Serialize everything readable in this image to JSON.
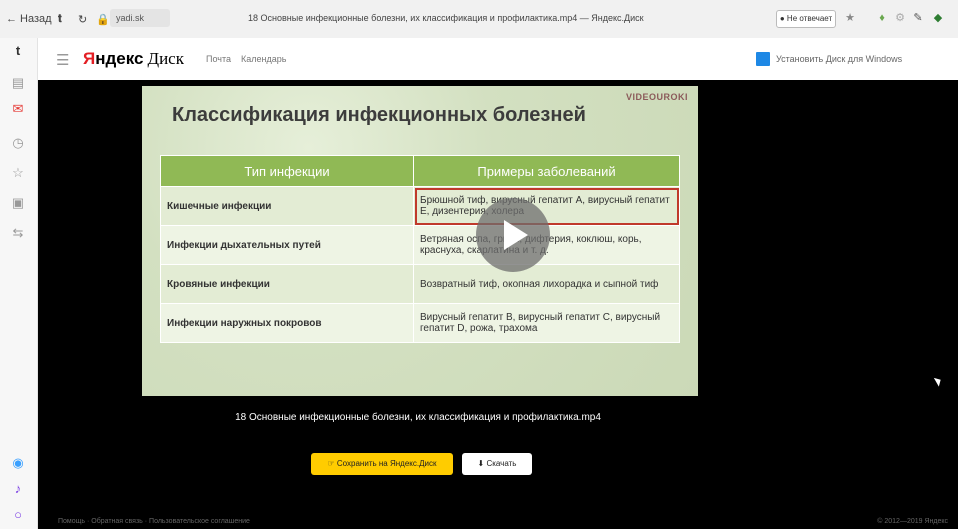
{
  "browser": {
    "back_label": "← Назад",
    "url_text": "yadi.sk",
    "tab_title": "18 Основные инфекционные болезни, их классификация и профилактика.mp4 — Яндекс.Диск",
    "ext_pill": "● Не отвечает",
    "icons": [
      "user-icon",
      "refresh-icon",
      "lock-icon",
      "extension-icon",
      "extension-icon",
      "extension-icon",
      "extension-icon"
    ]
  },
  "rail": {
    "items": [
      {
        "name": "rail-tab-icon-1",
        "glyph": "t",
        "color": "#333"
      },
      {
        "name": "rail-tab-icon-2",
        "glyph": "▤",
        "color": "#999"
      },
      {
        "name": "rail-mail-icon",
        "glyph": "✉",
        "color": "#e53935"
      },
      {
        "name": "rail-clock-icon",
        "glyph": "◷",
        "color": "#999"
      },
      {
        "name": "rail-star-icon",
        "glyph": "☆",
        "color": "#999"
      },
      {
        "name": "rail-notes-icon",
        "glyph": "▣",
        "color": "#999"
      },
      {
        "name": "rail-translate-icon",
        "glyph": "⇆",
        "color": "#999"
      }
    ],
    "bottom": [
      {
        "name": "rail-alice-icon",
        "glyph": "◉",
        "color": "#3aa0ff"
      },
      {
        "name": "rail-music-icon",
        "glyph": "♪",
        "color": "#7b3fe4"
      },
      {
        "name": "rail-ring-icon",
        "glyph": "○",
        "color": "#7b3fe4"
      }
    ]
  },
  "header": {
    "logo_red": "Я",
    "logo_black": "ндекс",
    "logo_disk": "Диск",
    "links": [
      "Почта",
      "Календарь"
    ],
    "install_label": "Установить Диск для Windows"
  },
  "slide": {
    "brand": "VIDEOUROKI",
    "title": "Классификация инфекционных болезней",
    "col1": "Тип инфекции",
    "col2": "Примеры заболеваний",
    "rows": [
      {
        "type": "Кишечные инфекции",
        "examples": "Брюшной тиф, вирусный гепатит А, вирусный гепатит Е, дизентерия, холера"
      },
      {
        "type": "Инфекции дыхательных путей",
        "examples": "Ветряная оспа, грипп, дифтерия, коклюш, корь, краснуха, скарлатина и т. д."
      },
      {
        "type": "Кровяные инфекции",
        "examples": "Возвратный тиф, окопная лихорадка и сыпной тиф"
      },
      {
        "type": "Инфекции наружных покровов",
        "examples": "Вирусный гепатит В, вирусный гепатит С, вирусный гепатит D, рожа, трахома"
      }
    ]
  },
  "viewer": {
    "caption": "18 Основные инфекционные болезни, их классификация и профилактика.mp4",
    "save_label": "☞ Сохранить на Яндекс.Диск",
    "download_label": "⬇ Скачать",
    "footer_left": "Помощь · Обратная связь · Пользовательское соглашение",
    "footer_right": "© 2012—2019 Яндекс"
  }
}
